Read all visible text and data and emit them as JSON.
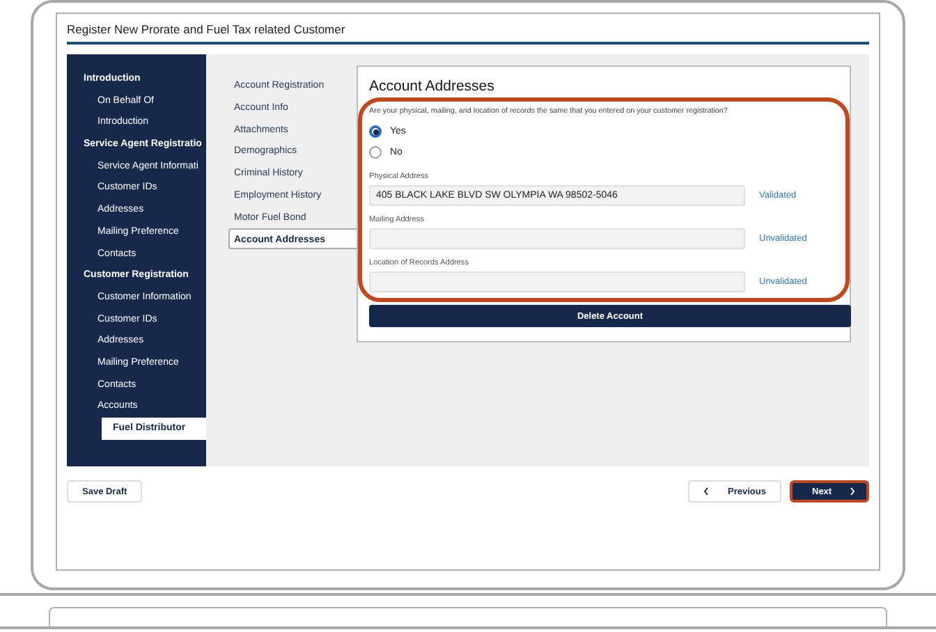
{
  "window": {
    "title": "Register New Prorate and Fuel Tax related Customer"
  },
  "sidebar": {
    "sections": [
      {
        "label": "Introduction",
        "items": [
          {
            "label": "On Behalf Of",
            "selected": false
          },
          {
            "label": "Introduction",
            "selected": false
          }
        ]
      },
      {
        "label": "Service Agent Registratio",
        "items": [
          {
            "label": "Service Agent Informati",
            "selected": false
          },
          {
            "label": "Customer IDs",
            "selected": false
          },
          {
            "label": "Addresses",
            "selected": false
          },
          {
            "label": "Mailing Preference",
            "selected": false
          },
          {
            "label": "Contacts",
            "selected": false
          }
        ]
      },
      {
        "label": "Customer Registration",
        "items": [
          {
            "label": "Customer Information",
            "selected": false
          },
          {
            "label": "Customer IDs",
            "selected": false
          },
          {
            "label": "Addresses",
            "selected": false
          },
          {
            "label": "Mailing Preference",
            "selected": false
          },
          {
            "label": "Contacts",
            "selected": false
          },
          {
            "label": "Accounts",
            "selected": false,
            "children": [
              {
                "label": "Fuel Distributor",
                "selected": true
              }
            ]
          }
        ]
      }
    ]
  },
  "steps": [
    {
      "label": "Account Registration",
      "selected": false
    },
    {
      "label": "Account Info",
      "selected": false
    },
    {
      "label": "Attachments",
      "selected": false
    },
    {
      "label": "Demographics",
      "selected": false
    },
    {
      "label": "Criminal History",
      "selected": false
    },
    {
      "label": "Employment History",
      "selected": false
    },
    {
      "label": "Motor Fuel Bond",
      "selected": false
    },
    {
      "label": "Account Addresses",
      "selected": true
    }
  ],
  "form": {
    "title": "Account Addresses",
    "highlighted": true,
    "question": "Are your physical, mailing, and location of records the same that you entered on your customer registration?",
    "options": [
      {
        "label": "Yes",
        "selected": true
      },
      {
        "label": "No",
        "selected": false
      }
    ],
    "addresses": [
      {
        "label": "Physical Address",
        "value": "405 BLACK LAKE BLVD SW OLYMPIA WA 98502-5046",
        "status": "Validated"
      },
      {
        "label": "Mailing Address",
        "status": "Unvalidated"
      },
      {
        "label": "Location of Records Address",
        "status": "Unvalidated"
      }
    ],
    "delete_button": "Delete Account"
  },
  "footer": {
    "save_button": "Save Draft",
    "previous_button": "Previous",
    "next_button": {
      "label": "Next",
      "highlighted": true
    }
  }
}
